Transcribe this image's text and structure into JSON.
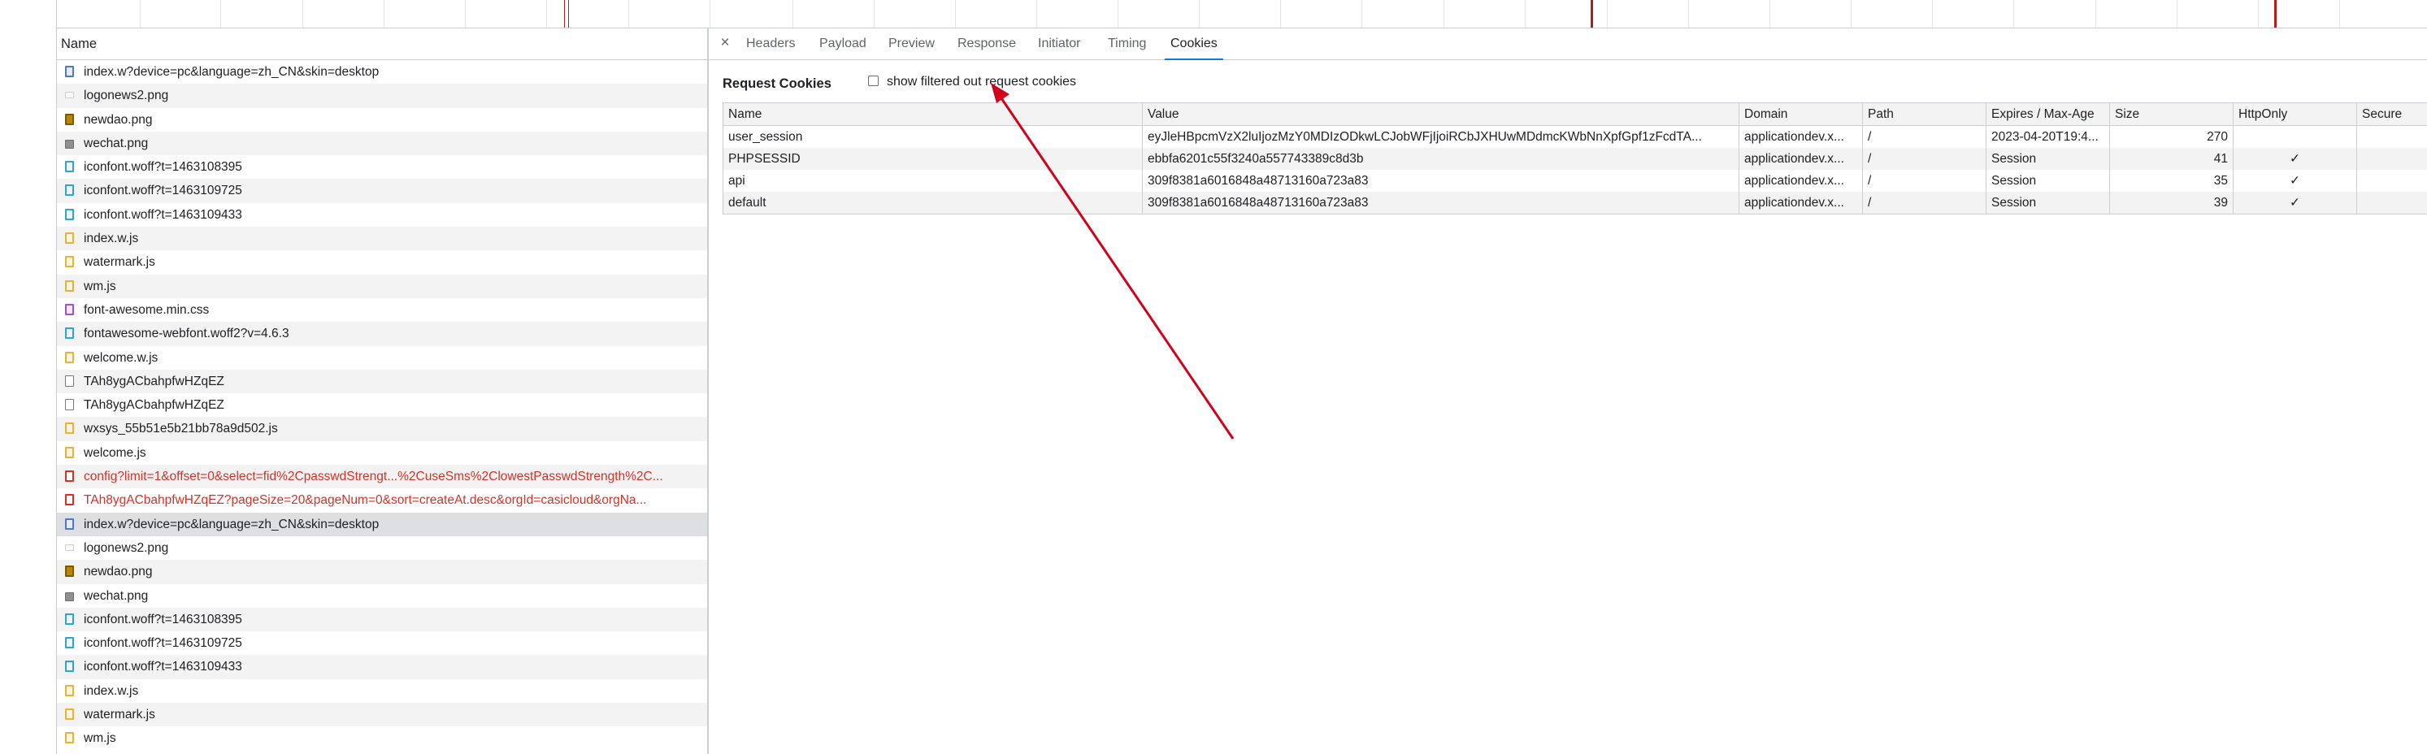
{
  "timeline": {
    "marker_color": "#b71c1c"
  },
  "request_list": {
    "header": "Name",
    "rows": [
      {
        "name": "index.w?device=pc&language=zh_CN&skin=desktop",
        "icon": "doc-icon",
        "status": "normal"
      },
      {
        "name": "logonews2.png",
        "icon": "png-icon",
        "status": "normal"
      },
      {
        "name": "newdao.png",
        "icon": "image-icon",
        "status": "normal"
      },
      {
        "name": "wechat.png",
        "icon": "image-icon",
        "status": "normal"
      },
      {
        "name": "iconfont.woff?t=1463108395",
        "icon": "font-icon",
        "status": "normal"
      },
      {
        "name": "iconfont.woff?t=1463109725",
        "icon": "font-icon",
        "status": "normal"
      },
      {
        "name": "iconfont.woff?t=1463109433",
        "icon": "font-icon",
        "status": "normal"
      },
      {
        "name": "index.w.js",
        "icon": "script-icon",
        "status": "normal"
      },
      {
        "name": "watermark.js",
        "icon": "script-icon",
        "status": "normal"
      },
      {
        "name": "wm.js",
        "icon": "script-icon",
        "status": "normal"
      },
      {
        "name": "font-awesome.min.css",
        "icon": "stylesheet-icon",
        "status": "normal"
      },
      {
        "name": "fontawesome-webfont.woff2?v=4.6.3",
        "icon": "font-icon",
        "status": "normal"
      },
      {
        "name": "welcome.w.js",
        "icon": "script-icon",
        "status": "normal"
      },
      {
        "name": "TAh8ygACbahpfwHZqEZ",
        "icon": "fetch-icon",
        "status": "normal"
      },
      {
        "name": "TAh8ygACbahpfwHZqEZ",
        "icon": "fetch-icon",
        "status": "normal"
      },
      {
        "name": "wxsys_55b51e5b21bb78a9d502.js",
        "icon": "script-icon",
        "status": "normal"
      },
      {
        "name": "welcome.js",
        "icon": "script-icon",
        "status": "normal"
      },
      {
        "name": "config?limit=1&offset=0&select=fid%2CpasswdStrengt...%2CuseSms%2ClowestPasswdStrength%2C...",
        "icon": "error-icon",
        "status": "error"
      },
      {
        "name": "TAh8ygACbahpfwHZqEZ?pageSize=20&pageNum=0&sort=createAt.desc&orgId=casicloud&orgNa...",
        "icon": "error-icon",
        "status": "error"
      },
      {
        "name": "index.w?device=pc&language=zh_CN&skin=desktop",
        "icon": "doc-icon",
        "status": "selected"
      },
      {
        "name": "logonews2.png",
        "icon": "png-icon",
        "status": "normal"
      },
      {
        "name": "newdao.png",
        "icon": "image-icon",
        "status": "normal"
      },
      {
        "name": "wechat.png",
        "icon": "image-icon",
        "status": "normal"
      },
      {
        "name": "iconfont.woff?t=1463108395",
        "icon": "font-icon",
        "status": "normal"
      },
      {
        "name": "iconfont.woff?t=1463109725",
        "icon": "font-icon",
        "status": "normal"
      },
      {
        "name": "iconfont.woff?t=1463109433",
        "icon": "font-icon",
        "status": "normal"
      },
      {
        "name": "index.w.js",
        "icon": "script-icon",
        "status": "normal"
      },
      {
        "name": "watermark.js",
        "icon": "script-icon",
        "status": "normal"
      },
      {
        "name": "wm.js",
        "icon": "script-icon",
        "status": "normal"
      }
    ]
  },
  "detail": {
    "close_icon": "close-icon",
    "close_glyph": "×",
    "tabs": [
      {
        "label": "Headers",
        "active": false
      },
      {
        "label": "Payload",
        "active": false
      },
      {
        "label": "Preview",
        "active": false
      },
      {
        "label": "Response",
        "active": false
      },
      {
        "label": "Initiator",
        "active": false
      },
      {
        "label": "Timing",
        "active": false
      },
      {
        "label": "Cookies",
        "active": true
      }
    ],
    "cookies": {
      "title": "Request Cookies",
      "filter_label": "show filtered out request cookies",
      "filter_checked": false,
      "columns": [
        "Name",
        "Value",
        "Domain",
        "Path",
        "Expires / Max-Age",
        "Size",
        "HttpOnly",
        "Secure"
      ],
      "rows": [
        {
          "name": "user_session",
          "value": "eyJleHBpcmVzX2luIjozMzY0MDIzODkwLCJobWFjIjoiRCbJXHUwMDdmcKWbNnXpfGpf1zFcdTA...",
          "domain": "applicationdev.x...",
          "path": "/",
          "expires": "2023-04-20T19:4...",
          "size": "270",
          "httponly": "",
          "secure": ""
        },
        {
          "name": "PHPSESSID",
          "value": "ebbfa6201c55f3240a557743389c8d3b",
          "domain": "applicationdev.x...",
          "path": "/",
          "expires": "Session",
          "size": "41",
          "httponly": "✓",
          "secure": ""
        },
        {
          "name": "api",
          "value": "309f8381a6016848a48713160a723a83",
          "domain": "applicationdev.x...",
          "path": "/",
          "expires": "Session",
          "size": "35",
          "httponly": "✓",
          "secure": ""
        },
        {
          "name": "default",
          "value": "309f8381a6016848a48713160a723a83",
          "domain": "applicationdev.x...",
          "path": "/",
          "expires": "Session",
          "size": "39",
          "httponly": "✓",
          "secure": ""
        }
      ]
    }
  },
  "annotation": {
    "arrow_color": "#d0021b"
  },
  "colors": {
    "accent": "#1a73e8",
    "error_text": "#d93025",
    "selected_row": "#dedfe3",
    "stripe": "#f3f3f3"
  }
}
